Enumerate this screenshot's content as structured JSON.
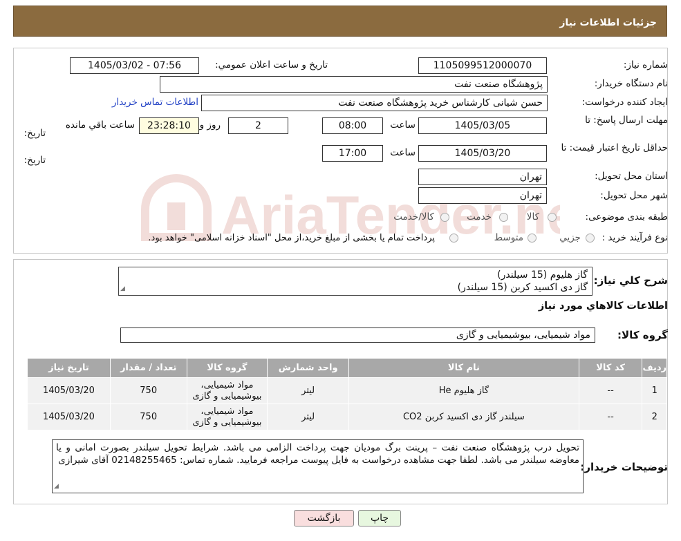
{
  "header": {
    "title": "جزئیات اطلاعات نیاز"
  },
  "form": {
    "need_number_label": "شماره نیاز:",
    "need_number": "1105099512000070",
    "announce_label": "تاریخ و ساعت اعلان عمومي:",
    "announce_value": "1405/03/02 - 07:56",
    "buyer_org_label": "نام دستگاه خریدار:",
    "buyer_org": "پژوهشگاه صنعت نفت",
    "creator_label": "ایجاد کننده درخواست:",
    "creator": "حسن شیانی کارشناس خرید پژوهشگاه صنعت نفت",
    "contact_link": "اطلاعات تماس خریدار",
    "deadline_label_1": "مهلت ارسال پاسخ: تا",
    "deadline_label_2": "تاریخ:",
    "deadline_date": "1405/03/05",
    "time_label": "ساعت",
    "deadline_time": "08:00",
    "days_value": "2",
    "days_label": "روز و",
    "remaining_time": "23:28:10",
    "remaining_label": "ساعت باقي مانده",
    "validity_label_1": "حداقل تاریخ اعتبار قیمت: تا",
    "validity_label_2": "تاریخ:",
    "validity_date": "1405/03/20",
    "validity_time": "17:00",
    "province_label": "استان محل تحویل:",
    "province": "تهران",
    "city_label": "شهر محل تحویل:",
    "city": "تهران",
    "category_label": "طبقه بندی موضوعی:",
    "category_options": [
      "کالا",
      "خدمت",
      "کالا/خدمت"
    ],
    "process_label": "نوع فرآیند خرید :",
    "process_options": [
      "جزیي",
      "متوسط"
    ],
    "process_note": "پرداخت تمام یا بخشی از مبلغ خرید،از محل \"اسناد خزانه اسلامی\" خواهد بود."
  },
  "summary": {
    "label": "شرح کلي نیاز:",
    "line1": "گاز هلیوم (15 سیلندر)",
    "line2": "گاز دی اکسید کربن (15 سیلندر)"
  },
  "goods": {
    "section_title": "اطلاعات کالاهاي مورد نیاز",
    "group_label": "گروه کالا:",
    "group_value": "مواد شیمیایی، بیوشیمیایی و  گازی",
    "columns": [
      "ردیف",
      "کد کالا",
      "نام کالا",
      "واحد شمارش",
      "گروه کالا",
      "تعداد / مقدار",
      "تاریخ نیاز"
    ],
    "rows": [
      [
        "1",
        "--",
        "گاز هلیوم He",
        "لیتر",
        "مواد شیمیایی، بیوشیمیایی و گازی",
        "750",
        "1405/03/20"
      ],
      [
        "2",
        "--",
        "سیلندر گاز دی اکسید کربن CO2",
        "لیتر",
        "مواد شیمیایی، بیوشیمیایی و گازی",
        "750",
        "1405/03/20"
      ]
    ]
  },
  "notes": {
    "label": "توضیحات خریدار:",
    "text": "تحویل درب پژوهشگاه صنعت نفت – پرینت برگ مودیان جهت پرداخت الزامی می باشد. شرایط تحویل سیلندر بصورت امانی و یا معاوضه سیلندر می باشد. لطفا جهت مشاهده درخواست به فایل پیوست مراجعه فرمایید. شماره تماس: 02148255465 آقای شیرازی"
  },
  "buttons": {
    "print": "چاپ",
    "back": "بازگشت"
  },
  "watermark": {
    "text": "AriaTender.neT"
  },
  "colors": {
    "header_bg": "#8b6b3f",
    "table_header": "#a8a8a8",
    "back_button": "#f9dede",
    "print_button": "#e7f7df",
    "link": "#1f3fc4"
  }
}
